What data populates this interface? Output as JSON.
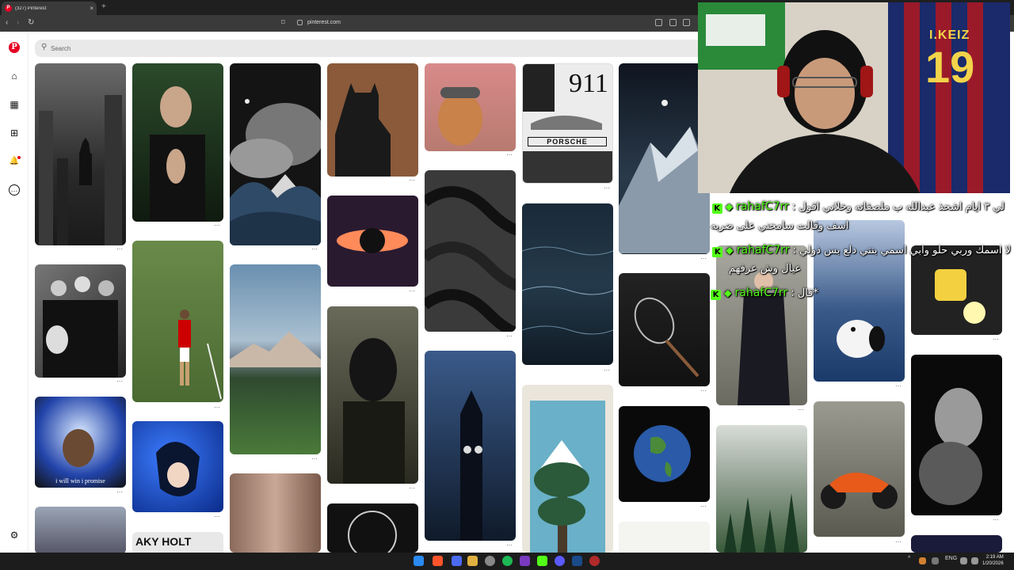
{
  "browser": {
    "tab_title": "(327) Pinterest",
    "tab_favicon": "P",
    "new_tab_label": "+",
    "tab_close": "×",
    "url": "pinterest.com",
    "nav_back": "‹",
    "nav_forward": "›",
    "nav_reload": "↻",
    "bookmark_glyph": "⌑"
  },
  "pinterest": {
    "logo": "P",
    "search_placeholder": "Search",
    "search_glyph": "⚲",
    "sidebar": {
      "home_glyph": "⌂",
      "explore_glyph": "▦",
      "create_glyph": "⊞",
      "notifications_glyph": "🔔",
      "messages_glyph": "…",
      "settings_glyph": "⚙"
    },
    "pin_more": "···",
    "pin_caption_kanye": "i will win i promise",
    "pin_911_text": "911",
    "pin_porsche_text": "PORSCHE",
    "pin_hood_text": "AKY HOLT"
  },
  "webcam": {
    "jersey_name": "I.KEIZ",
    "jersey_number": "19"
  },
  "chat": {
    "badge": "K",
    "diamond": "◆",
    "messages": [
      {
        "user": "rahafC7rr",
        "sep": ":",
        "text": "لي ٣ ايام اشحذ عبدالله ب ملصقاته وخلاني اقول",
        "cont": "اسف وقالت سامحني على ضربه"
      },
      {
        "user": "rahafC7rr",
        "sep": ":",
        "text": "لا اسمك وربي حلو وابي اسمي بنتي دلع بس ذولي",
        "cont": "عيال وش عرفهم"
      },
      {
        "user": "rahafC7rr",
        "sep": ":",
        "text": "قال*"
      }
    ]
  },
  "taskbar": {
    "language": "ENG",
    "time": "2:19 AM",
    "date": "1/20/2026"
  }
}
